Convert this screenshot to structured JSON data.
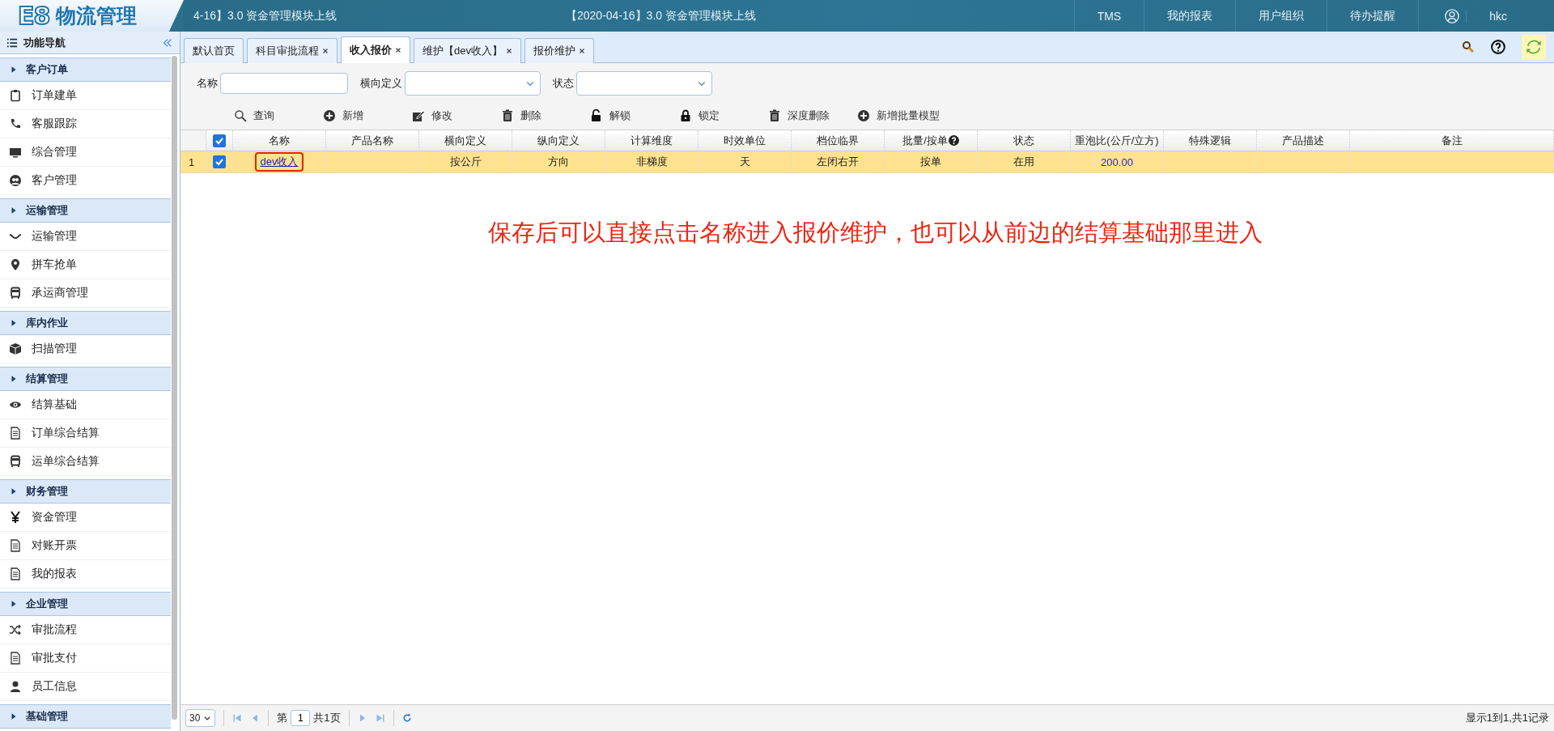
{
  "header": {
    "logo": {
      "mark": "E8",
      "name": "物流管理"
    },
    "notices": [
      "4-16】3.0 资金管理模块上线",
      "【2020-04-16】3.0 资金管理模块上线"
    ],
    "nav": [
      "TMS",
      "我的报表",
      "用户组织",
      "待办提醒"
    ],
    "user": "hkc"
  },
  "sidebar": {
    "title": "功能导航",
    "groups": [
      {
        "title": "客户订单",
        "expanded": true,
        "items": [
          "订单建单",
          "客服跟踪",
          "综合管理",
          "客户管理"
        ]
      },
      {
        "title": "运输管理",
        "expanded": true,
        "items": [
          "运输管理",
          "拼车抢单",
          "承运商管理"
        ]
      },
      {
        "title": "库内作业",
        "expanded": true,
        "items": [
          "扫描管理"
        ]
      },
      {
        "title": "结算管理",
        "expanded": true,
        "items": [
          "结算基础",
          "订单综合结算",
          "运单综合结算"
        ]
      },
      {
        "title": "财务管理",
        "expanded": true,
        "items": [
          "资金管理",
          "对账开票",
          "我的报表"
        ]
      },
      {
        "title": "企业管理",
        "expanded": true,
        "items": [
          "审批流程",
          "审批支付",
          "员工信息"
        ]
      },
      {
        "title": "基础管理",
        "expanded": true
      }
    ]
  },
  "tabs": [
    {
      "label": "默认首页",
      "closable": false,
      "selected": false
    },
    {
      "label": "科目审批流程",
      "closable": true,
      "selected": false
    },
    {
      "label": "收入报价",
      "closable": true,
      "selected": true
    },
    {
      "label": "维护【dev收入】",
      "closable": true,
      "selected": false
    },
    {
      "label": "报价维护",
      "closable": true,
      "selected": false
    }
  ],
  "filters": [
    {
      "label": "名称",
      "kind": "text"
    },
    {
      "label": "横向定义",
      "kind": "select"
    },
    {
      "label": "状态",
      "kind": "select"
    }
  ],
  "toolbar": [
    "查询",
    "新增",
    "修改",
    "删除",
    "解锁",
    "锁定",
    "深度删除",
    "新增批量模型"
  ],
  "table": {
    "all_checked": true,
    "columns": [
      {
        "label": "名称",
        "kind": "link"
      },
      {
        "label": "产品名称"
      },
      {
        "label": "横向定义"
      },
      {
        "label": "纵向定义"
      },
      {
        "label": "计算维度"
      },
      {
        "label": "时效单位"
      },
      {
        "label": "档位临界"
      },
      {
        "label": "批量/按单",
        "help": true
      },
      {
        "label": "状态"
      },
      {
        "label": "重泡比(公斤/立方)",
        "kind": "number"
      },
      {
        "label": "特殊逻辑"
      },
      {
        "label": "产品描述"
      },
      {
        "label": "备注"
      }
    ],
    "rows": [
      {
        "number": "1",
        "checked": true,
        "selected": true,
        "circled": true,
        "cells": [
          "dev收入",
          "",
          "按公斤",
          "方向",
          "非梯度",
          "天",
          "左闭右开",
          "按单",
          "在用",
          "200.00",
          "",
          "",
          ""
        ]
      }
    ]
  },
  "annotation": "保存后可以直接点击名称进入报价维护，也可以从前边的结算基础那里进入",
  "pager": {
    "page_size": "30",
    "page_prefix": "第",
    "page": "1",
    "page_suffix": "共1页",
    "summary": "显示1到1,共1记录"
  }
}
